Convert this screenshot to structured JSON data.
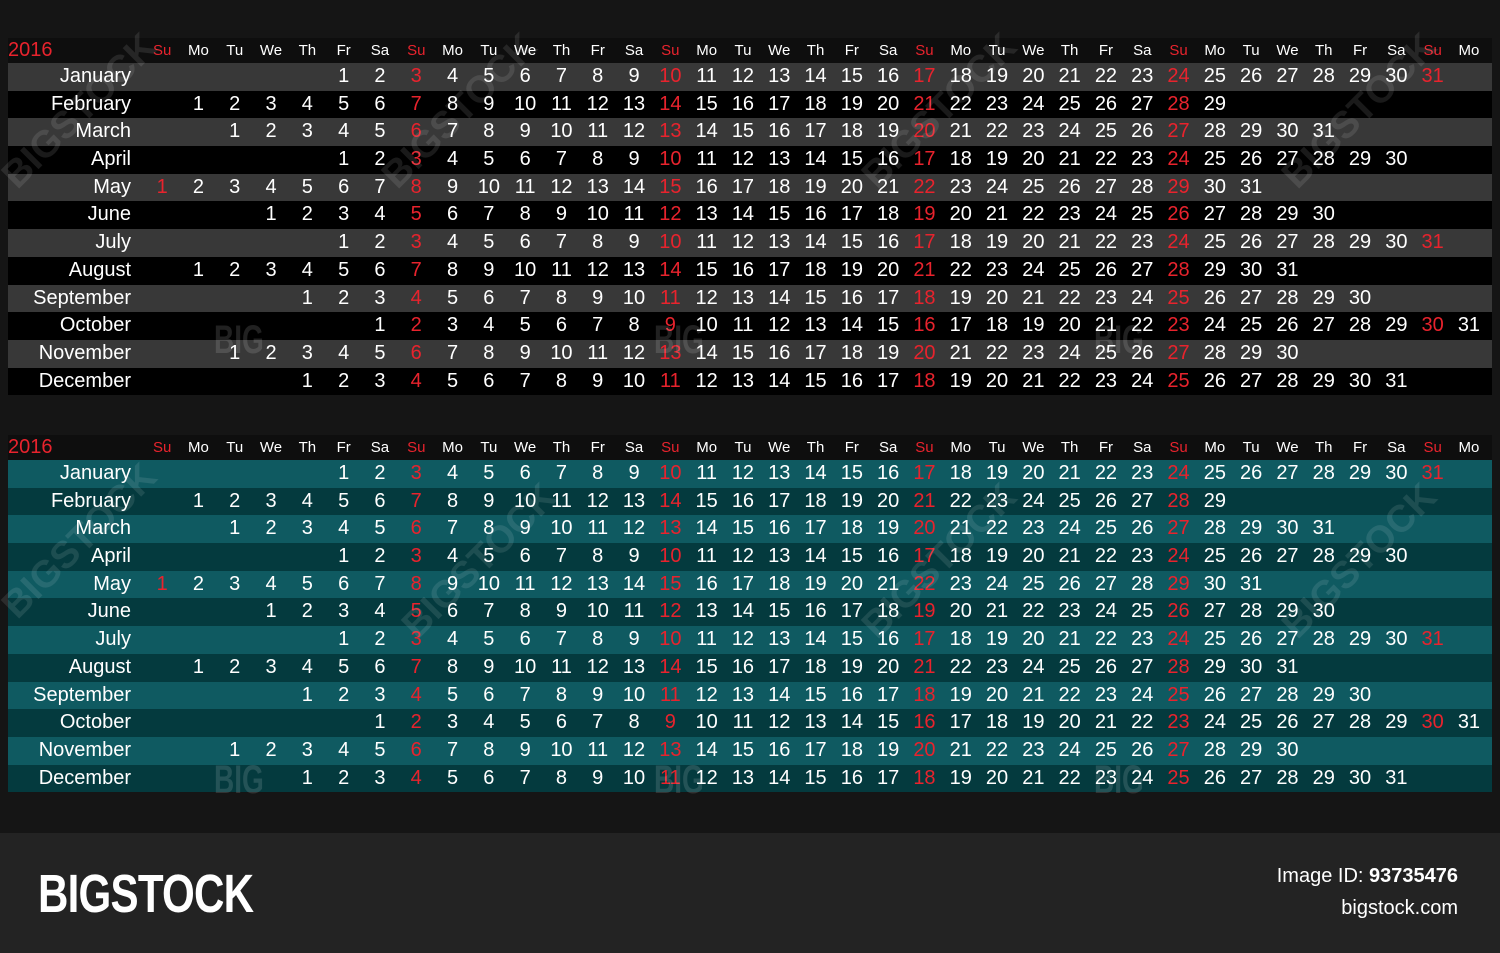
{
  "year": "2016",
  "weekdays": [
    "Su",
    "Mo",
    "Tu",
    "We",
    "Th",
    "Fr",
    "Sa",
    "Su",
    "Mo",
    "Tu",
    "We",
    "Th",
    "Fr",
    "Sa",
    "Su",
    "Mo",
    "Tu",
    "We",
    "Th",
    "Fr",
    "Sa",
    "Su",
    "Mo",
    "Tu",
    "We",
    "Th",
    "Fr",
    "Sa",
    "Su",
    "Mo",
    "Tu",
    "We",
    "Th",
    "Fr",
    "Sa",
    "Su",
    "Mo"
  ],
  "months": [
    {
      "name": "January",
      "start": 5,
      "days": 31
    },
    {
      "name": "February",
      "start": 1,
      "days": 29
    },
    {
      "name": "March",
      "start": 2,
      "days": 31
    },
    {
      "name": "April",
      "start": 5,
      "days": 30
    },
    {
      "name": "May",
      "start": 0,
      "days": 31
    },
    {
      "name": "June",
      "start": 3,
      "days": 30
    },
    {
      "name": "July",
      "start": 5,
      "days": 31
    },
    {
      "name": "August",
      "start": 1,
      "days": 31
    },
    {
      "name": "September",
      "start": 4,
      "days": 30
    },
    {
      "name": "October",
      "start": 6,
      "days": 31
    },
    {
      "name": "November",
      "start": 2,
      "days": 30
    },
    {
      "name": "December",
      "start": 4,
      "days": 31
    }
  ],
  "colors": {
    "sunday": "#e8232d",
    "top_row_light": "#383838",
    "top_row_dark": "#000000",
    "bottom_row_light": "#0f5a61",
    "bottom_row_dark": "#043a3e"
  },
  "footer": {
    "logo": "BIGSTOCK",
    "image_id_label": "Image ID:",
    "image_id_value": "93735476",
    "site": "bigstock.com"
  },
  "watermark": {
    "diagonal": "BIGSTOCK",
    "small": "BIG"
  }
}
